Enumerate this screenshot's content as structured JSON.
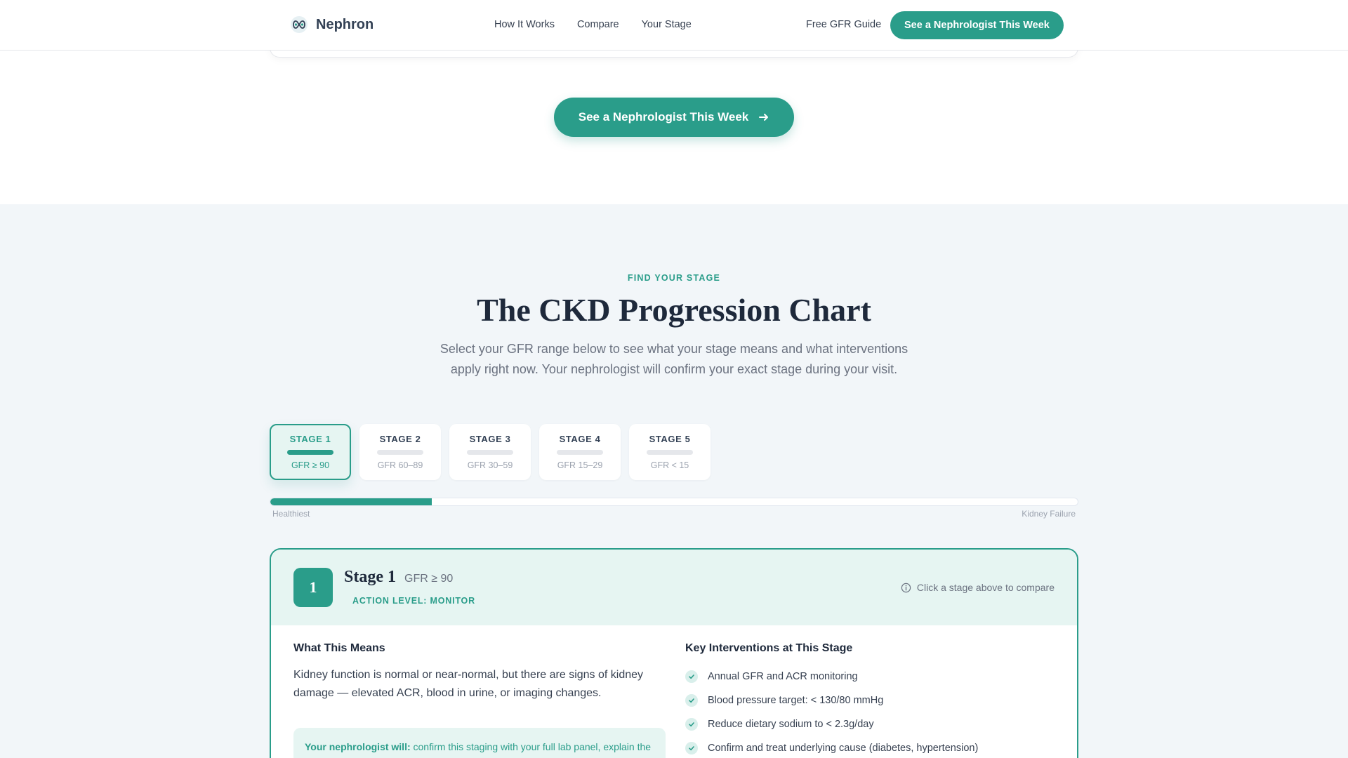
{
  "header": {
    "brand": "Nephron",
    "nav": [
      "How It Works",
      "Compare",
      "Your Stage"
    ],
    "guide_link": "Free GFR Guide",
    "cta": "See a Nephrologist This Week"
  },
  "hero": {
    "cta": "See a Nephrologist This Week",
    "cta_icon": "arrow-right-icon"
  },
  "stage_section": {
    "eyebrow": "FIND YOUR STAGE",
    "title": "The CKD Progression Chart",
    "subtitle": "Select your GFR range below to see what your stage means and what interventions apply right now. Your nephrologist will confirm your exact stage during your visit.",
    "tabs": [
      {
        "label": "STAGE 1",
        "gfr": "GFR ≥ 90",
        "active": true
      },
      {
        "label": "STAGE 2",
        "gfr": "GFR 60–89",
        "active": false
      },
      {
        "label": "STAGE 3",
        "gfr": "GFR 30–59",
        "active": false
      },
      {
        "label": "STAGE 4",
        "gfr": "GFR 15–29",
        "active": false
      },
      {
        "label": "STAGE 5",
        "gfr": "GFR < 15",
        "active": false
      }
    ],
    "progress_fraction": 0.2,
    "scale": {
      "left": "Healthiest",
      "right": "Kidney Failure"
    },
    "detail": {
      "badge": "1",
      "name": "Stage 1",
      "gfr": "GFR ≥ 90",
      "action_level": "ACTION LEVEL: MONITOR",
      "compare_hint": "Click a stage above to compare",
      "means_heading": "What This Means",
      "means_text": "Kidney function is normal or near-normal, but there are signs of kidney damage — elevated ACR, blood in urine, or imaging changes.",
      "callout_lead": "Your nephrologist will:",
      "callout_text": " confirm this staging with your full lab panel, explain the trajectory, and tell you exactly what changes will slow the progression.",
      "interventions_heading": "Key Interventions at This Stage",
      "interventions": [
        "Annual GFR and ACR monitoring",
        "Blood pressure target: < 130/80 mmHg",
        "Reduce dietary sodium to < 2.3g/day",
        "Confirm and treat underlying cause (diabetes, hypertension)"
      ]
    }
  },
  "colors": {
    "accent": "#2a9d8a",
    "accent_light": "#e6f5f2",
    "section_bg": "#f2f6f9"
  }
}
